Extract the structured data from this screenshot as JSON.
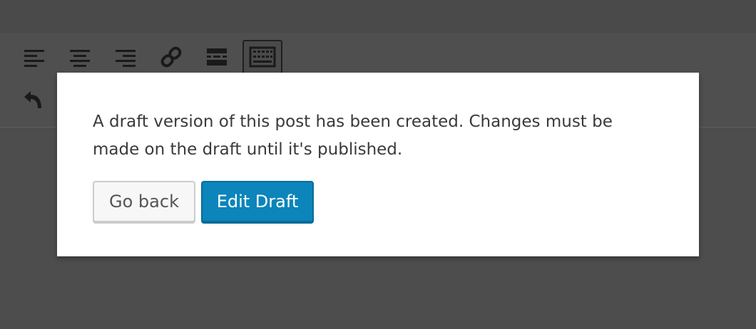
{
  "toolbar": {
    "icons": [
      "align-left-icon",
      "align-center-icon",
      "align-right-icon",
      "link-icon",
      "read-more-icon",
      "toolbar-toggle-icon",
      "undo-icon"
    ],
    "active_icon": "toolbar-toggle-icon",
    "icon_color": "#1a1a1a"
  },
  "modal": {
    "message": "A draft version of this post has been created. Changes must be made on the draft until it's published.",
    "go_back_label": "Go back",
    "edit_draft_label": "Edit Draft",
    "primary_color": "#0b85ba"
  }
}
